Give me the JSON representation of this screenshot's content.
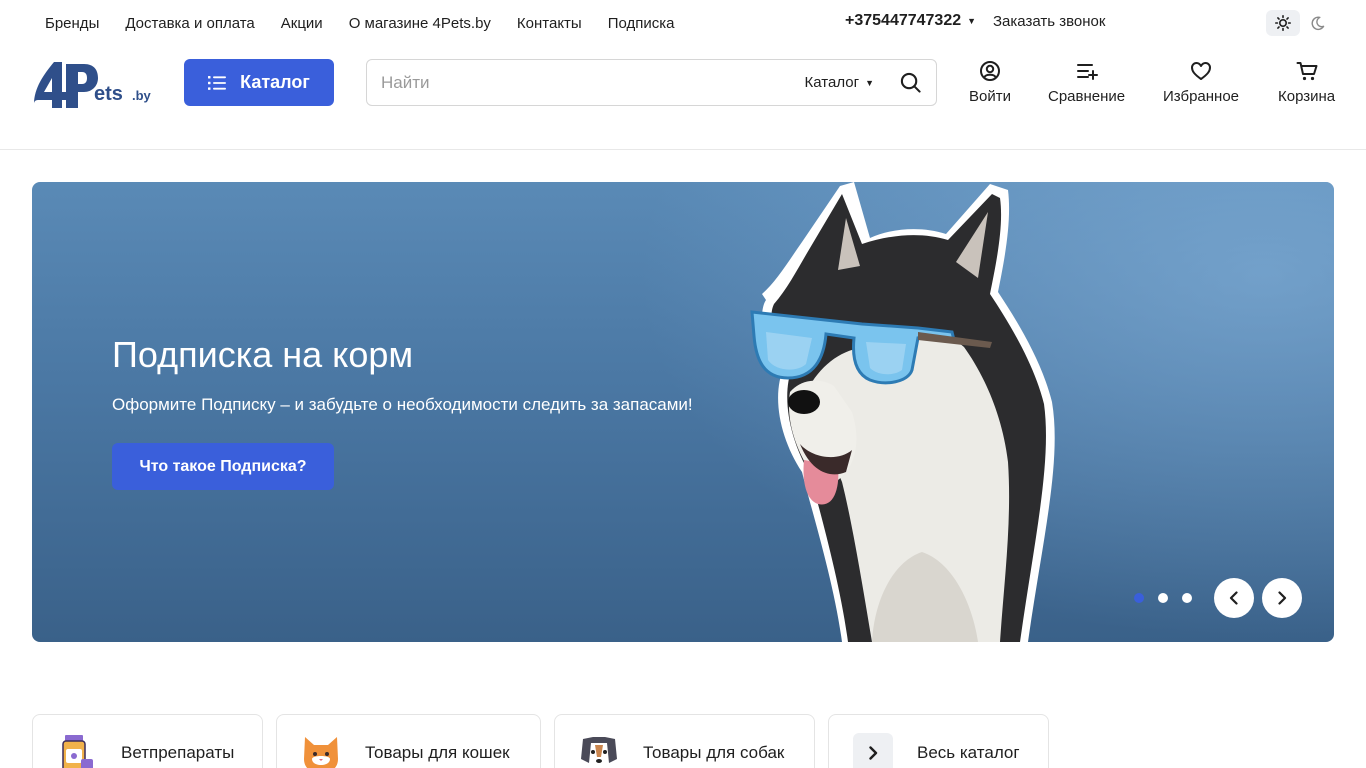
{
  "topnav": {
    "links": [
      "Бренды",
      "Доставка и оплата",
      "Акции",
      "О магазине 4Pets.by",
      "Контакты",
      "Подписка"
    ],
    "phone": "+375447747322",
    "callback": "Заказать звонок"
  },
  "header": {
    "logo_text": "4Pets.by",
    "catalog_button": "Каталог",
    "search_placeholder": "Найти",
    "search_category": "Каталог",
    "login": "Войти",
    "compare": "Сравнение",
    "favorites": "Избранное",
    "cart": "Корзина"
  },
  "banner": {
    "title": "Подписка на корм",
    "subtitle": "Оформите Подписку – и забудьте о необходимости следить за запасами!",
    "button": "Что такое Подписка?",
    "slides_total": 3,
    "active_slide": 1
  },
  "categories": [
    {
      "label": "Ветпрепараты",
      "icon": "medicine-icon"
    },
    {
      "label": "Товары для кошек",
      "icon": "cat-icon"
    },
    {
      "label": "Товары для собак",
      "icon": "dog-icon"
    },
    {
      "label": "Весь каталог",
      "icon": "chevron-right-icon"
    }
  ],
  "colors": {
    "accent": "#3a5fdb",
    "banner_top": "#5a8ab6",
    "banner_bottom": "#3a6189",
    "logo": "#2f4f8a"
  }
}
